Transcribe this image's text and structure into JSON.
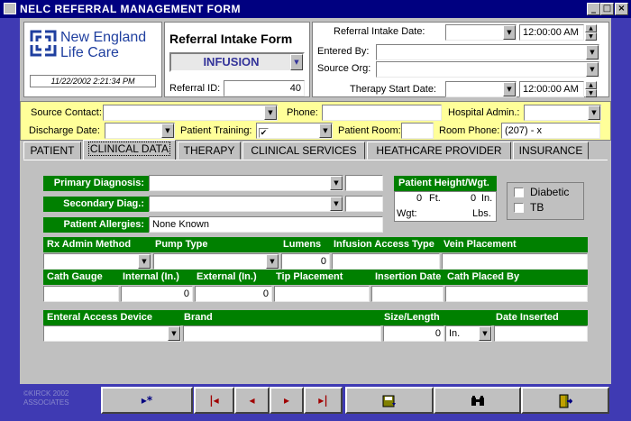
{
  "window": {
    "title": "NELC REFERRAL MANAGEMENT FORM",
    "controls": [
      "_",
      "□",
      "×"
    ]
  },
  "logo": {
    "line1": "New England",
    "line2": "Life Care"
  },
  "timestamp": "11/22/2002 2:21:34 PM",
  "intake": {
    "title": "Referral Intake Form",
    "type_value": "INFUSION",
    "referral_id_label": "Referral ID:",
    "referral_id_value": "40"
  },
  "header": {
    "intake_date_label": "Referral Intake Date:",
    "intake_time": "12:00:00 AM",
    "entered_by_label": "Entered By:",
    "source_org_label": "Source Org:",
    "therapy_start_label": "Therapy Start Date:",
    "therapy_time": "12:00:00 AM"
  },
  "contact": {
    "source_contact_label": "Source Contact:",
    "phone_label": "Phone:",
    "hospital_admin_label": "Hospital Admin.:",
    "discharge_label": "Discharge Date:",
    "patient_training_label": "Patient Training:",
    "patient_room_label": "Patient Room:",
    "room_phone_label": "Room Phone:",
    "room_phone_value": "(207)   -      x"
  },
  "tabs": [
    "PATIENT",
    "CLINICAL DATA",
    "THERAPY",
    "CLINICAL SERVICES",
    "HEATHCARE PROVIDER",
    "INSURANCE"
  ],
  "clinical": {
    "primary_dx_label": "Primary Diagnosis:",
    "secondary_dx_label": "Secondary Diag.:",
    "allergies_label": "Patient Allergies:",
    "allergies_value": "None Known",
    "height_weight_label": "Patient Height/Wgt.",
    "feet_value": "0",
    "feet_unit": "Ft.",
    "inches_value": "0",
    "inches_unit": "In.",
    "wgt_label": "Wgt:",
    "lbs_unit": "Lbs.",
    "diabetic_label": "Diabetic",
    "tb_label": "TB"
  },
  "infusion": {
    "rx_admin_label": "Rx Admin Method",
    "pump_type_label": "Pump Type",
    "lumens_label": "Lumens",
    "lumens_value": "0",
    "access_type_label": "Infusion Access Type",
    "vein_label": "Vein Placement",
    "cath_gauge_label": "Cath Gauge",
    "internal_label": "Internal (In.)",
    "internal_value": "0",
    "external_label": "External (In.)",
    "external_value": "0",
    "tip_label": "Tip Placement",
    "insertion_label": "Insertion Date",
    "cath_placed_label": "Cath Placed By"
  },
  "enteral": {
    "device_label": "Enteral Access Device",
    "brand_label": "Brand",
    "size_label": "Size/Length",
    "size_value": "0",
    "size_unit": "In.",
    "date_label": "Date Inserted"
  },
  "footer": {
    "copyright_line1": "©KIRCK 2002",
    "copyright_line2": "ASSOCIATES",
    "new_record": "▸*",
    "first": "|◂",
    "prev": "◂",
    "next": "▸",
    "last": "▸|",
    "save_icon": "save-icon",
    "find_icon": "binoculars-icon",
    "exit_icon": "exit-door-icon"
  }
}
